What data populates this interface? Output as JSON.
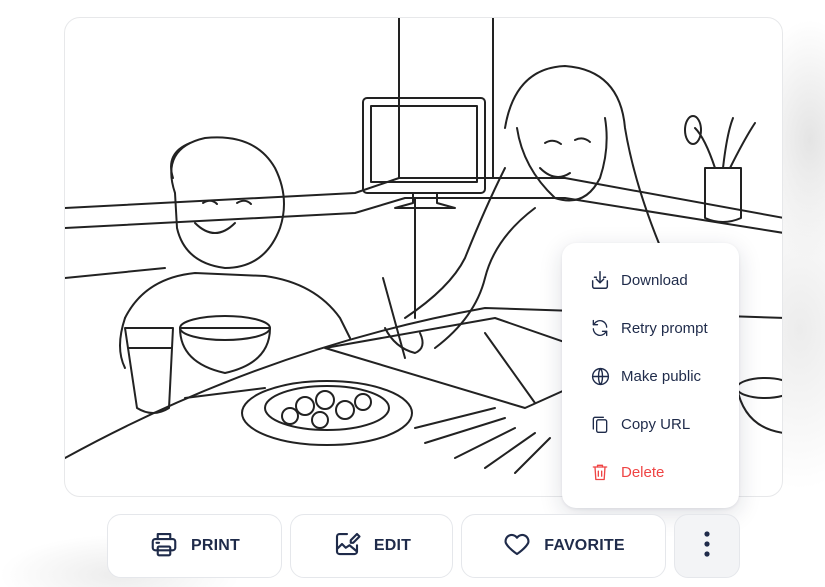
{
  "image": {
    "subject": "coloring page line art"
  },
  "actions": {
    "print_label": "PRINT",
    "edit_label": "EDIT",
    "favorite_label": "FAVORITE"
  },
  "menu": {
    "items": [
      {
        "label": "Download",
        "icon": "download-icon"
      },
      {
        "label": "Retry prompt",
        "icon": "refresh-icon"
      },
      {
        "label": "Make public",
        "icon": "globe-icon"
      },
      {
        "label": "Copy URL",
        "icon": "copy-icon"
      },
      {
        "label": "Delete",
        "icon": "trash-icon"
      }
    ]
  },
  "colors": {
    "text": "#1f2b4a",
    "danger": "#ef4444",
    "border": "#e5e7eb"
  }
}
